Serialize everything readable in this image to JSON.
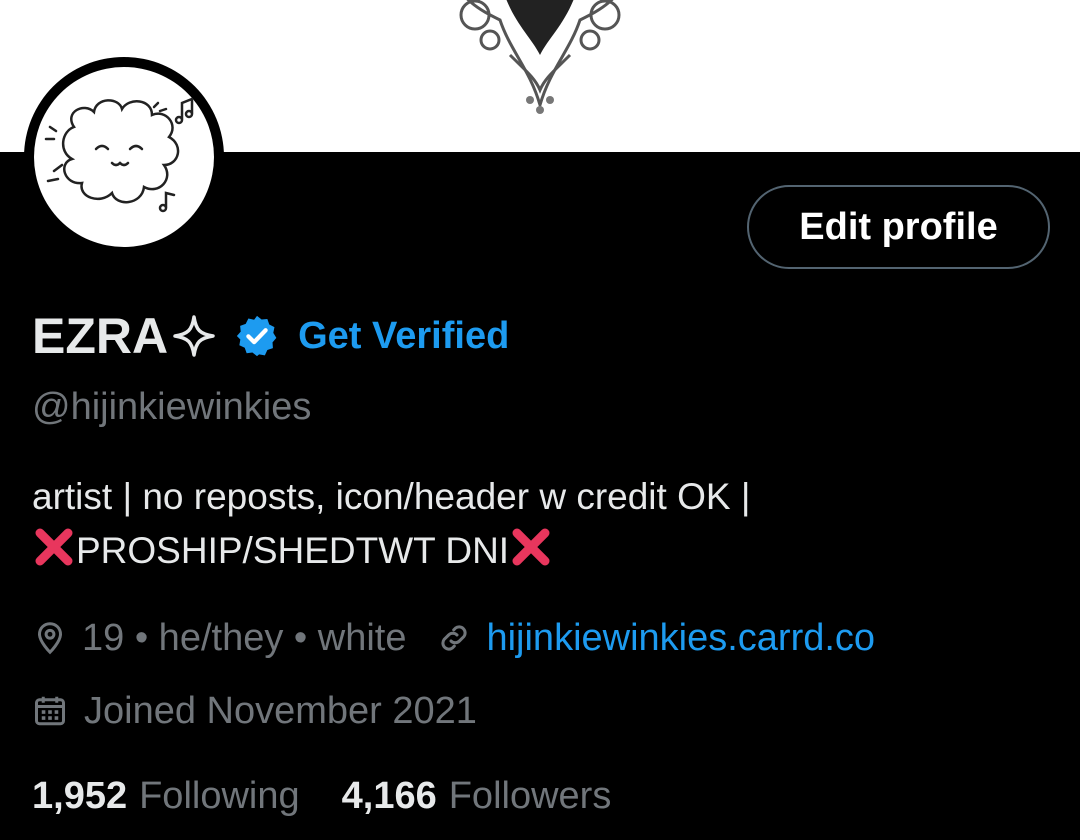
{
  "profile": {
    "display_name": "EZRA",
    "get_verified_label": "Get Verified",
    "handle": "@hijinkiewinkies",
    "edit_button_label": "Edit profile",
    "bio_line1": "artist | no reposts, icon/header w credit OK |",
    "bio_line2": "PROSHIP/SHEDTWT DNI",
    "location": "19 • he/they • white",
    "website": "hijinkiewinkies.carrd.co",
    "joined": "Joined November 2021"
  },
  "stats": {
    "following_count": "1,952",
    "following_label": "Following",
    "followers_count": "4,166",
    "followers_label": "Followers"
  },
  "colors": {
    "accent": "#1d9bf0",
    "background": "#000000",
    "secondary_text": "#71767b",
    "primary_text": "#e7e9ea",
    "cross_emoji": "#e8365d"
  },
  "icons": {
    "verified": "verified-badge-icon",
    "location": "location-pin-icon",
    "link": "link-icon",
    "calendar": "calendar-icon",
    "sparkle": "sparkle-icon",
    "cross": "cross-mark-emoji"
  }
}
